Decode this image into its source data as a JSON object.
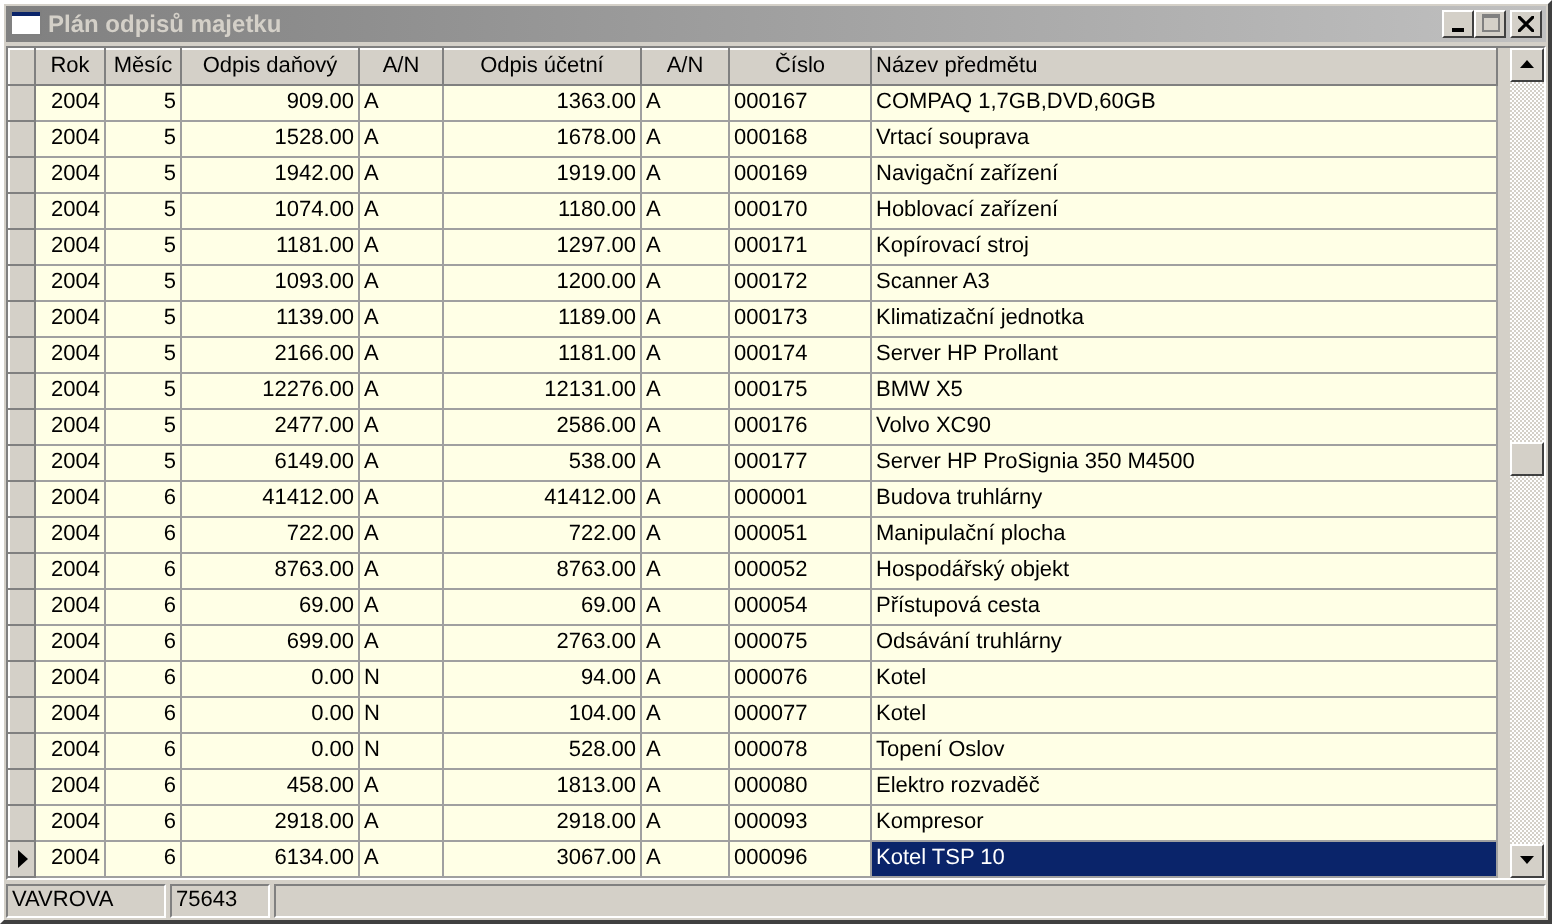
{
  "window": {
    "title": "Plán odpisů majetku"
  },
  "table": {
    "columns": [
      "Rok",
      "Měsíc",
      "Odpis daňový",
      "A/N",
      "Odpis účetní",
      "A/N",
      "Číslo",
      "Název předmětu"
    ],
    "rows": [
      {
        "cells": [
          "2004",
          "5",
          "909.00",
          "A",
          "1363.00",
          "A",
          "000167",
          "COMPAQ 1,7GB,DVD,60GB"
        ],
        "selected": false
      },
      {
        "cells": [
          "2004",
          "5",
          "1528.00",
          "A",
          "1678.00",
          "A",
          "000168",
          "Vrtací souprava"
        ],
        "selected": false
      },
      {
        "cells": [
          "2004",
          "5",
          "1942.00",
          "A",
          "1919.00",
          "A",
          "000169",
          "Navigační zařízení"
        ],
        "selected": false
      },
      {
        "cells": [
          "2004",
          "5",
          "1074.00",
          "A",
          "1180.00",
          "A",
          "000170",
          "Hoblovací zařízení"
        ],
        "selected": false
      },
      {
        "cells": [
          "2004",
          "5",
          "1181.00",
          "A",
          "1297.00",
          "A",
          "000171",
          "Kopírovací stroj"
        ],
        "selected": false
      },
      {
        "cells": [
          "2004",
          "5",
          "1093.00",
          "A",
          "1200.00",
          "A",
          "000172",
          "Scanner A3"
        ],
        "selected": false
      },
      {
        "cells": [
          "2004",
          "5",
          "1139.00",
          "A",
          "1189.00",
          "A",
          "000173",
          "Klimatizační jednotka"
        ],
        "selected": false
      },
      {
        "cells": [
          "2004",
          "5",
          "2166.00",
          "A",
          "1181.00",
          "A",
          "000174",
          "Server HP Prollant"
        ],
        "selected": false
      },
      {
        "cells": [
          "2004",
          "5",
          "12276.00",
          "A",
          "12131.00",
          "A",
          "000175",
          "BMW X5"
        ],
        "selected": false
      },
      {
        "cells": [
          "2004",
          "5",
          "2477.00",
          "A",
          "2586.00",
          "A",
          "000176",
          "Volvo XC90"
        ],
        "selected": false
      },
      {
        "cells": [
          "2004",
          "5",
          "6149.00",
          "A",
          "538.00",
          "A",
          "000177",
          "Server HP ProSignia 350 M4500"
        ],
        "selected": false
      },
      {
        "cells": [
          "2004",
          "6",
          "41412.00",
          "A",
          "41412.00",
          "A",
          "000001",
          "Budova truhlárny"
        ],
        "selected": false
      },
      {
        "cells": [
          "2004",
          "6",
          "722.00",
          "A",
          "722.00",
          "A",
          "000051",
          "Manipulační plocha"
        ],
        "selected": false
      },
      {
        "cells": [
          "2004",
          "6",
          "8763.00",
          "A",
          "8763.00",
          "A",
          "000052",
          "Hospodářský objekt"
        ],
        "selected": false
      },
      {
        "cells": [
          "2004",
          "6",
          "69.00",
          "A",
          "69.00",
          "A",
          "000054",
          "Přístupová cesta"
        ],
        "selected": false
      },
      {
        "cells": [
          "2004",
          "6",
          "699.00",
          "A",
          "2763.00",
          "A",
          "000075",
          "Odsávání truhlárny"
        ],
        "selected": false
      },
      {
        "cells": [
          "2004",
          "6",
          "0.00",
          "N",
          "94.00",
          "A",
          "000076",
          "Kotel"
        ],
        "selected": false
      },
      {
        "cells": [
          "2004",
          "6",
          "0.00",
          "N",
          "104.00",
          "A",
          "000077",
          "Kotel"
        ],
        "selected": false
      },
      {
        "cells": [
          "2004",
          "6",
          "0.00",
          "N",
          "528.00",
          "A",
          "000078",
          "Topení Oslov"
        ],
        "selected": false
      },
      {
        "cells": [
          "2004",
          "6",
          "458.00",
          "A",
          "1813.00",
          "A",
          "000080",
          "Elektro rozvaděč"
        ],
        "selected": false
      },
      {
        "cells": [
          "2004",
          "6",
          "2918.00",
          "A",
          "2918.00",
          "A",
          "000093",
          "Kompresor"
        ],
        "selected": false
      },
      {
        "cells": [
          "2004",
          "6",
          "6134.00",
          "A",
          "3067.00",
          "A",
          "000096",
          "Kotel TSP 10"
        ],
        "selected": true
      }
    ]
  },
  "status_bar": [
    "VAVROVA",
    "75643"
  ]
}
